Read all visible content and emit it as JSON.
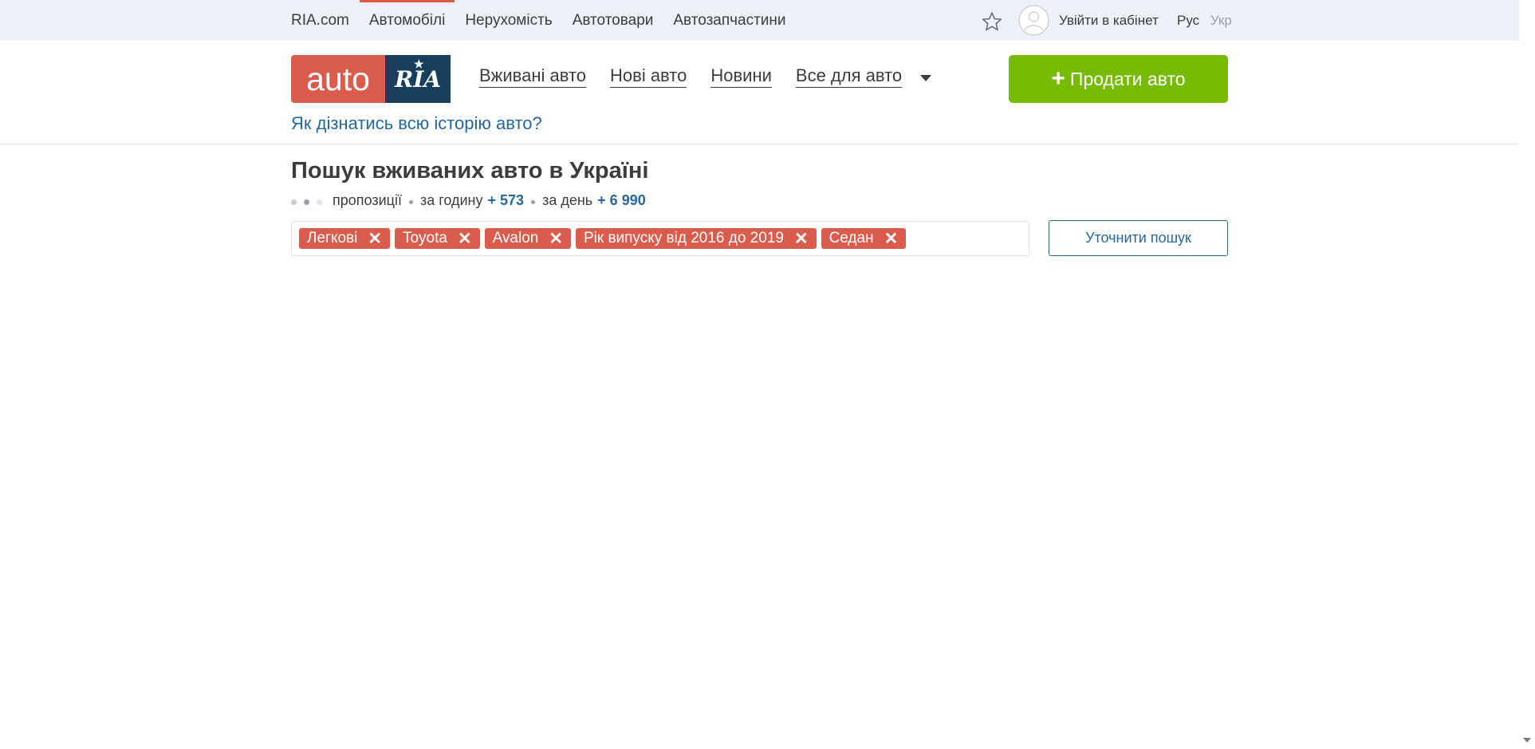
{
  "topbar": {
    "links": [
      "RIA.com",
      "Автомобілі",
      "Нерухомість",
      "Автотовари",
      "Автозапчастини"
    ],
    "active_index": 1,
    "login_label": "Увійти в кабінет",
    "lang_ru": "Рус",
    "lang_ua": "Укр"
  },
  "header": {
    "logo_auto": "auto",
    "logo_ria": "RIA",
    "nav": [
      "Вживані авто",
      "Нові авто",
      "Новини",
      "Все для авто"
    ],
    "sell_label": "Продати авто",
    "history_link": "Як дізнатись всю історію авто?"
  },
  "search": {
    "title": "Пошук вживаних авто в Україні",
    "offers_label": "пропозиції",
    "per_hour_label": "за годину",
    "per_hour_value": "+ 573",
    "per_day_label": "за день",
    "per_day_value": "+ 6 990",
    "tags": [
      "Легкові",
      "Toyota",
      "Avalon",
      "Рік випуску від 2016 до 2019",
      "Седан"
    ],
    "refine_label": "Уточнити пошук"
  },
  "colors": {
    "brand_red": "#db5c4c",
    "brand_navy": "#173e5a",
    "sell_green": "#76bb00",
    "link_blue": "#256799"
  }
}
